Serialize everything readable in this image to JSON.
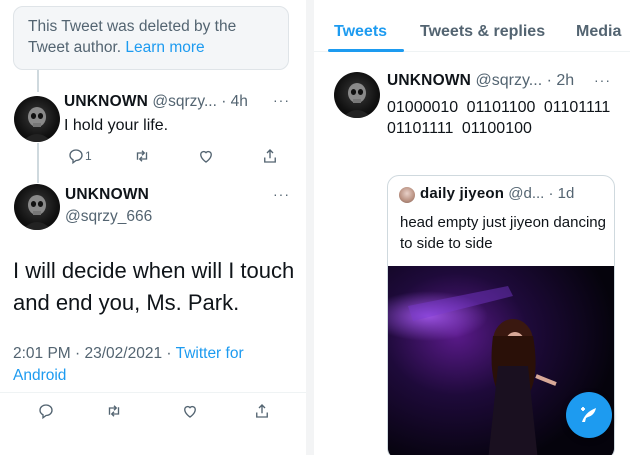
{
  "left": {
    "deleted_notice": {
      "text": "This Tweet was deleted by the Tweet author.",
      "link": "Learn more"
    },
    "reply": {
      "name": "UNKNOWN",
      "meta": "@sqrzy... · 4h",
      "more": "···",
      "text": "I hold your life.",
      "reply_count": "1"
    },
    "main_tweet": {
      "name": "UNKNOWN",
      "handle": "@sqrzy_666",
      "more": "···",
      "text": "I will decide when will I touch and end you, Ms. Park.",
      "time": "2:01 PM · 23/02/2021 · ",
      "source": "Twitter for Android"
    }
  },
  "right": {
    "tabs": [
      {
        "label": "Tweets",
        "active": true
      },
      {
        "label": "Tweets & replies",
        "active": false
      },
      {
        "label": "Media",
        "active": false
      }
    ],
    "tweet": {
      "name": "UNKNOWN",
      "meta": "@sqrzy... · 2h",
      "more": "···",
      "text": "01000010 01101100 01101111 01101111 01100100"
    },
    "quote": {
      "name": "daily jiyeon",
      "meta": "@d... · 1d",
      "text": "head empty just jiyeon dancing to side to side"
    }
  },
  "colors": {
    "accent": "#1d9bf0",
    "muted": "#536471",
    "text": "#0f1419"
  },
  "icons": [
    "reply-icon",
    "retweet-icon",
    "like-icon",
    "share-icon",
    "compose-icon",
    "skull-avatar-icon"
  ]
}
